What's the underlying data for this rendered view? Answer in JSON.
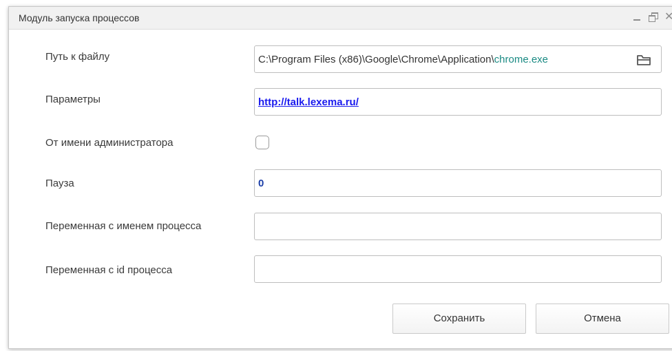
{
  "window": {
    "title": "Модуль запуска процессов",
    "controls": {
      "minimize_icon": "minimize-icon",
      "restore_icon": "restore-icon",
      "close_icon": "close-icon",
      "close_glyph": "✕"
    }
  },
  "form": {
    "file_path": {
      "label": "Путь к файлу",
      "value_dir": "C:\\Program Files (x86)\\Google\\Chrome\\Application\\",
      "value_exe": "chrome.exe",
      "browse_icon": "folder-icon"
    },
    "parameters": {
      "label": "Параметры",
      "value": "http://talk.lexema.ru/"
    },
    "run_as_admin": {
      "label": "От имени администратора",
      "checked": false
    },
    "pause": {
      "label": "Пауза",
      "value": "0"
    },
    "process_name_var": {
      "label": "Переменная с именем процесса",
      "value": ""
    },
    "process_id_var": {
      "label": "Переменная с id  процесса",
      "value": ""
    }
  },
  "buttons": {
    "save": "Сохранить",
    "cancel": "Отмена"
  },
  "colors": {
    "exe_highlight": "#1a8a83",
    "link": "#1a1aee",
    "number": "#1c3fa8",
    "titlebar_bg": "#f1f1f1"
  }
}
